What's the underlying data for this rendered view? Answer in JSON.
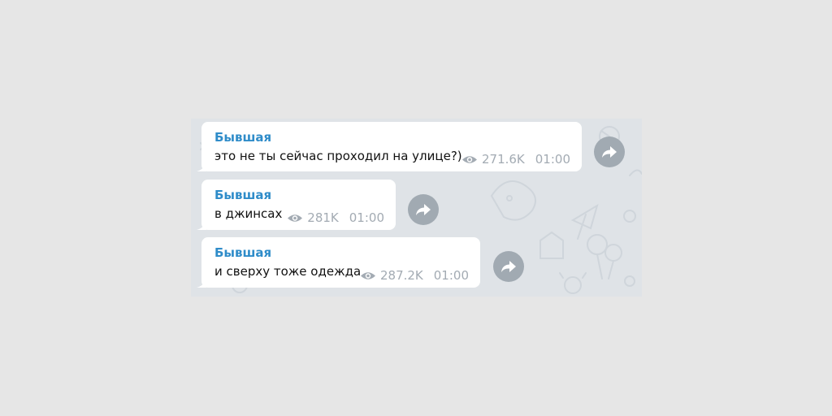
{
  "messages": [
    {
      "sender": "Бывшая",
      "text": "это не ты сейчас проходил на улице?)",
      "views": "271.6K",
      "time": "01:00"
    },
    {
      "sender": "Бывшая",
      "text": "в джинсах",
      "views": "281K",
      "time": "01:00"
    },
    {
      "sender": "Бывшая",
      "text": "и сверху тоже одежда",
      "views": "287.2K",
      "time": "01:00"
    }
  ],
  "icons": {
    "views": "eye-icon",
    "forward": "forward-arrow-icon"
  },
  "colors": {
    "page_background": "#e6e6e6",
    "chat_background": "#dfe3e7",
    "bubble": "#ffffff",
    "sender_name": "#2f8cc9",
    "message_text": "#111111",
    "meta_text": "#a3abb3",
    "forward_button": "#a1aab2"
  }
}
